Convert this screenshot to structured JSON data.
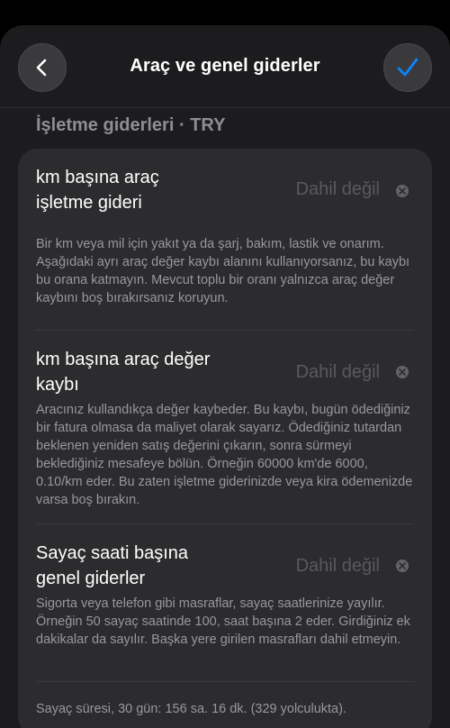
{
  "header": {
    "title": "Araç ve genel giderler",
    "back_icon": "chevron-left-icon",
    "confirm_icon": "checkmark-icon",
    "accent_color": "#0a84ff"
  },
  "section": {
    "title": "İşletme giderleri · TRY"
  },
  "rows": [
    {
      "label": "km başına araç işletme gideri",
      "value": "Dahil değil",
      "description": "Bir km veya mil için yakıt ya da şarj, bakım, lastik ve onarım. Aşağıdaki ayrı araç değer kaybı alanını kullanıyorsanız, bu kaybı bu orana katmayın. Mevcut toplu bir oranı yalnızca araç değer kaybını boş bırakırsanız koruyun."
    },
    {
      "label": "km başına araç değer kaybı",
      "value": "Dahil değil",
      "description": "Aracınız kullandıkça değer kaybeder. Bu kaybı, bugün ödediğiniz bir fatura olmasa da maliyet olarak sayarız. Ödediğiniz tutardan beklenen yeniden satış değerini çıkarın, sonra sürmeyi beklediğiniz mesafeye bölün. Örneğin 60000 km'de 6000, 0.10/km eder. Bu zaten işletme giderinizde veya kira ödemenizde varsa boş bırakın."
    },
    {
      "label": "Sayaç saati başına genel giderler",
      "value": "Dahil değil",
      "description": "Sigorta veya telefon gibi masraflar, sayaç saatlerinize yayılır. Örneğin 50 sayaç saatinde 100, saat başına 2 eder. Girdiğiniz ek dakikalar da sayılır. Başka yere girilen masrafları dahil etmeyin."
    }
  ],
  "footer": {
    "text": "Sayaç süresi, 30 gün: 156 sa. 16 dk. (329 yolculukta)."
  }
}
